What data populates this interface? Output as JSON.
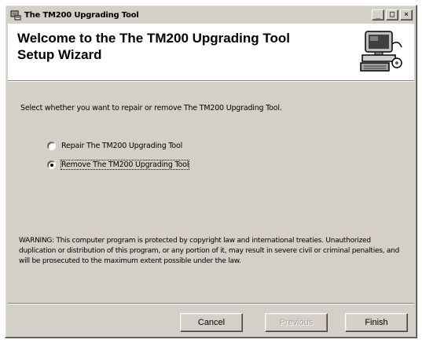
{
  "window": {
    "title": "The TM200 Upgrading Tool",
    "minimize_glyph": "_",
    "restore_glyph": "□",
    "close_glyph": "×"
  },
  "banner": {
    "title": "Welcome to the The TM200 Upgrading Tool Setup Wizard"
  },
  "content": {
    "instruction": "Select whether you want to repair or remove The TM200 Upgrading Tool.",
    "options": [
      {
        "label": "Repair The TM200 Upgrading Tool",
        "selected": false
      },
      {
        "label": "Remove The TM200 Upgrading Tool",
        "selected": true
      }
    ],
    "warning": "WARNING: This computer program is protected by copyright law and international treaties. Unauthorized duplication or distribution of this program, or any portion of it, may result in severe civil or criminal penalties, and will be prosecuted to the maximum extent possible under the law."
  },
  "buttons": {
    "cancel": "Cancel",
    "previous": "Previous",
    "finish": "Finish"
  }
}
